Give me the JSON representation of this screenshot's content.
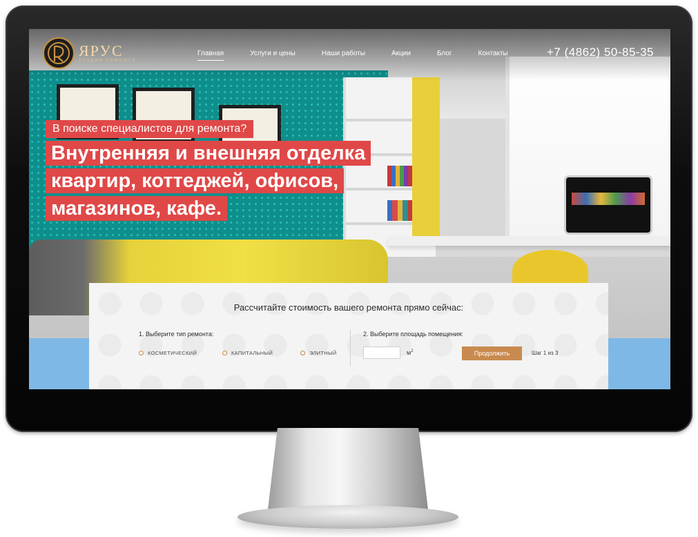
{
  "header": {
    "logo_name": "ЯРУС",
    "logo_sub": "СТУДИЯ РЕМОНТА",
    "phone": "+7 (4862) 50-85-35"
  },
  "nav": {
    "items": [
      {
        "label": "Главная",
        "active": true
      },
      {
        "label": "Услуги и цены",
        "active": false
      },
      {
        "label": "Наши работы",
        "active": false
      },
      {
        "label": "Акции",
        "active": false
      },
      {
        "label": "Блог",
        "active": false
      },
      {
        "label": "Контакты",
        "active": false
      }
    ]
  },
  "hero": {
    "kicker": "В поиске специалистов для ремонта?",
    "headline": "Внутренняя и внешняя отделка квартир, коттеджей, офисов, магазинов, кафе."
  },
  "calculator": {
    "title": "Рассчитайте стоимость вашего ремонта прямо сейчас:",
    "step1_label": "1. Выберите тип ремонта:",
    "step2_label": "2. Выберите площадь помещения:",
    "options": [
      "КОСМЕТИЧЕСКИЙ",
      "КАПИТАЛЬНЫЙ",
      "ЭЛИТНЫЙ"
    ],
    "area_value": "",
    "unit": "м",
    "unit_power": "2",
    "continue_label": "Продолжить",
    "step_counter": "Шаг 1 из 3"
  },
  "colors": {
    "accent_red": "#e04848",
    "accent_gold": "#c88a4e",
    "band_blue": "#7eb8e6"
  },
  "icons": [
    "logo-emblem-icon",
    "radio-circle-icon"
  ]
}
